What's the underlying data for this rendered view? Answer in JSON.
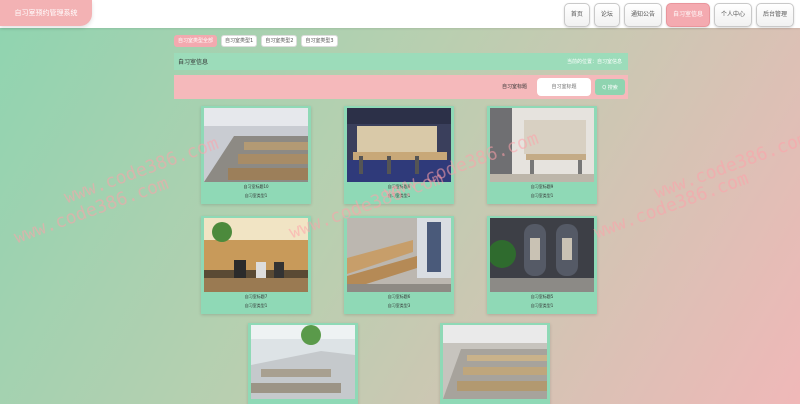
{
  "header": {
    "brand": "自习室预约管理系统",
    "nav": [
      {
        "label": "首页",
        "active": false
      },
      {
        "label": "论坛",
        "active": false
      },
      {
        "label": "通知公告",
        "active": false
      },
      {
        "label": "自习室信息",
        "active": true
      },
      {
        "label": "个人中心",
        "active": false
      },
      {
        "label": "后台管理",
        "active": false
      }
    ]
  },
  "tabs": [
    {
      "label": "自习室类型全部",
      "active": true
    },
    {
      "label": "自习室类型1",
      "active": false
    },
    {
      "label": "自习室类型2",
      "active": false
    },
    {
      "label": "自习室类型3",
      "active": false
    }
  ],
  "panel": {
    "title": "自习室信息",
    "breadcrumb": "当前的位置：自习室信息"
  },
  "search": {
    "label": "自习室标题",
    "placeholder": "自习室标题",
    "button": "Q 搜索"
  },
  "cards": [
    {
      "title": "自习室标题10",
      "type": "自习室类型1"
    },
    {
      "title": "自习室标题8",
      "type": "自习室类型1"
    },
    {
      "title": "自习室标题9",
      "type": "自习室类型1"
    },
    {
      "title": "自习室标题7",
      "type": "自习室类型1"
    },
    {
      "title": "自习室标题6",
      "type": "自习室类型3"
    },
    {
      "title": "自习室标题5",
      "type": "自习室类型1"
    },
    {
      "title": "",
      "type": ""
    },
    {
      "title": "",
      "type": ""
    }
  ],
  "watermark": "www.code386.com",
  "colors": {
    "accent_pink": "#f3a9af",
    "accent_green": "#8fd4b0"
  }
}
